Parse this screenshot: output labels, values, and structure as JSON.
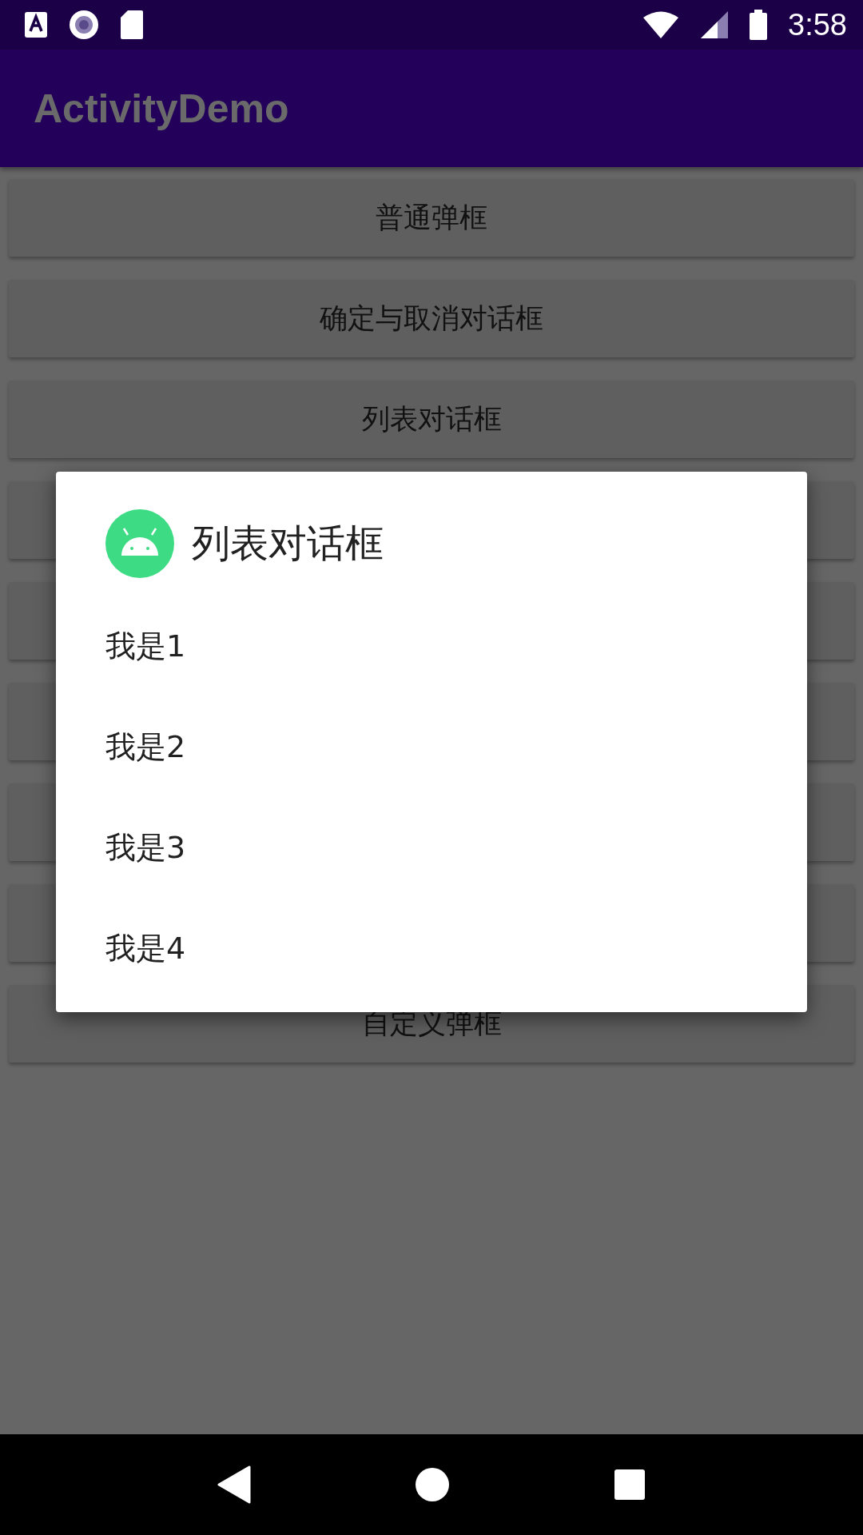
{
  "status_bar": {
    "time": "3:58"
  },
  "app_bar": {
    "title": "ActivityDemo"
  },
  "buttons": [
    {
      "kind": "labeled",
      "label": "普通弹框"
    },
    {
      "kind": "labeled",
      "label": "确定与取消对话框"
    },
    {
      "kind": "labeled",
      "label": "列表对话框"
    },
    {
      "kind": "covered"
    },
    {
      "kind": "covered"
    },
    {
      "kind": "covered"
    },
    {
      "kind": "covered"
    },
    {
      "kind": "covered"
    },
    {
      "kind": "labeled",
      "label": "自定义弹框"
    }
  ],
  "dialog": {
    "title": "列表对话框",
    "items": [
      "我是1",
      "我是2",
      "我是3",
      "我是4"
    ]
  }
}
